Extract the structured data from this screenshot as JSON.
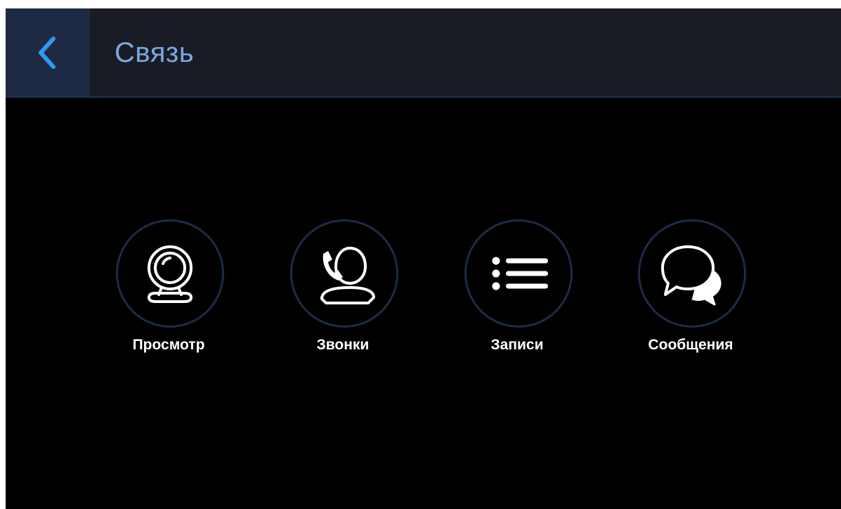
{
  "header": {
    "title": "Связь",
    "back_icon": "chevron-left-icon",
    "accent_color": "#2d9bf0"
  },
  "tiles": [
    {
      "label": "Просмотр",
      "icon": "webcam-icon"
    },
    {
      "label": "Звонки",
      "icon": "person-phone-icon"
    },
    {
      "label": "Записи",
      "icon": "list-icon"
    },
    {
      "label": "Сообщения",
      "icon": "chat-bubbles-icon"
    }
  ]
}
